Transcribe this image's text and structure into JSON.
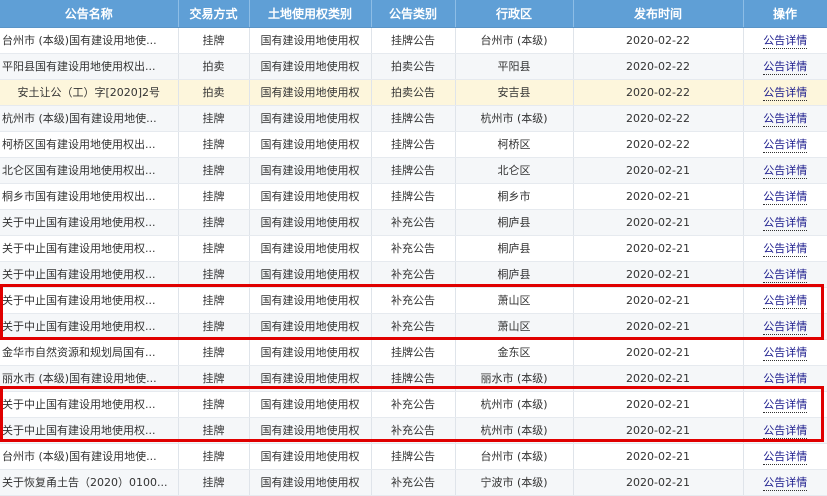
{
  "headers": [
    "公告名称",
    "交易方式",
    "土地使用权类别",
    "公告类别",
    "行政区",
    "发布时间",
    "操作"
  ],
  "rows": [
    {
      "name": "台州市 (本级)国有建设用地使...",
      "mode": "挂牌",
      "type": "国有建设用地使用权",
      "category": "挂牌公告",
      "district": "台州市 (本级)",
      "date": "2020-02-22",
      "op": "公告详情"
    },
    {
      "name": "平阳县国有建设用地使用权出...",
      "mode": "拍卖",
      "type": "国有建设用地使用权",
      "category": "拍卖公告",
      "district": "平阳县",
      "date": "2020-02-22",
      "op": "公告详情"
    },
    {
      "name": "安土让公（工）字[2020]2号",
      "mode": "拍卖",
      "type": "国有建设用地使用权",
      "category": "拍卖公告",
      "district": "安吉县",
      "date": "2020-02-22",
      "op": "公告详情"
    },
    {
      "name": "杭州市 (本级)国有建设用地使...",
      "mode": "挂牌",
      "type": "国有建设用地使用权",
      "category": "挂牌公告",
      "district": "杭州市 (本级)",
      "date": "2020-02-22",
      "op": "公告详情"
    },
    {
      "name": "柯桥区国有建设用地使用权出...",
      "mode": "挂牌",
      "type": "国有建设用地使用权",
      "category": "挂牌公告",
      "district": "柯桥区",
      "date": "2020-02-22",
      "op": "公告详情"
    },
    {
      "name": "北仑区国有建设用地使用权出...",
      "mode": "挂牌",
      "type": "国有建设用地使用权",
      "category": "挂牌公告",
      "district": "北仑区",
      "date": "2020-02-21",
      "op": "公告详情"
    },
    {
      "name": "桐乡市国有建设用地使用权出...",
      "mode": "挂牌",
      "type": "国有建设用地使用权",
      "category": "挂牌公告",
      "district": "桐乡市",
      "date": "2020-02-21",
      "op": "公告详情"
    },
    {
      "name": "关于中止国有建设用地使用权...",
      "mode": "挂牌",
      "type": "国有建设用地使用权",
      "category": "补充公告",
      "district": "桐庐县",
      "date": "2020-02-21",
      "op": "公告详情"
    },
    {
      "name": "关于中止国有建设用地使用权...",
      "mode": "挂牌",
      "type": "国有建设用地使用权",
      "category": "补充公告",
      "district": "桐庐县",
      "date": "2020-02-21",
      "op": "公告详情"
    },
    {
      "name": "关于中止国有建设用地使用权...",
      "mode": "挂牌",
      "type": "国有建设用地使用权",
      "category": "补充公告",
      "district": "桐庐县",
      "date": "2020-02-21",
      "op": "公告详情"
    },
    {
      "name": "关于中止国有建设用地使用权...",
      "mode": "挂牌",
      "type": "国有建设用地使用权",
      "category": "补充公告",
      "district": "萧山区",
      "date": "2020-02-21",
      "op": "公告详情"
    },
    {
      "name": "关于中止国有建设用地使用权...",
      "mode": "挂牌",
      "type": "国有建设用地使用权",
      "category": "补充公告",
      "district": "萧山区",
      "date": "2020-02-21",
      "op": "公告详情"
    },
    {
      "name": "金华市自然资源和规划局国有...",
      "mode": "挂牌",
      "type": "国有建设用地使用权",
      "category": "挂牌公告",
      "district": "金东区",
      "date": "2020-02-21",
      "op": "公告详情"
    },
    {
      "name": "丽水市 (本级)国有建设用地使...",
      "mode": "挂牌",
      "type": "国有建设用地使用权",
      "category": "挂牌公告",
      "district": "丽水市 (本级)",
      "date": "2020-02-21",
      "op": "公告详情"
    },
    {
      "name": "关于中止国有建设用地使用权...",
      "mode": "挂牌",
      "type": "国有建设用地使用权",
      "category": "补充公告",
      "district": "杭州市 (本级)",
      "date": "2020-02-21",
      "op": "公告详情"
    },
    {
      "name": "关于中止国有建设用地使用权...",
      "mode": "挂牌",
      "type": "国有建设用地使用权",
      "category": "补充公告",
      "district": "杭州市 (本级)",
      "date": "2020-02-21",
      "op": "公告详情"
    },
    {
      "name": "台州市 (本级)国有建设用地使...",
      "mode": "挂牌",
      "type": "国有建设用地使用权",
      "category": "挂牌公告",
      "district": "台州市 (本级)",
      "date": "2020-02-21",
      "op": "公告详情"
    },
    {
      "name": "关于恢复甬土告（2020）0100...",
      "mode": "挂牌",
      "type": "国有建设用地使用权",
      "category": "补充公告",
      "district": "宁波市 (本级)",
      "date": "2020-02-21",
      "op": "公告详情"
    }
  ],
  "highlight_row": 2,
  "colors": {
    "header": "#5f9fd6",
    "highlight": "#fdf6dc",
    "redbox": "#e00000",
    "link": "#1a1a8c"
  }
}
